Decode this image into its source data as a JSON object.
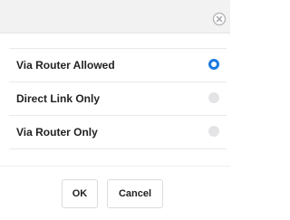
{
  "dialog": {
    "close_icon": "close-circle-icon",
    "options": [
      {
        "label": "Via Router Allowed",
        "selected": true
      },
      {
        "label": "Direct Link Only",
        "selected": false
      },
      {
        "label": "Via Router Only",
        "selected": false
      }
    ],
    "buttons": {
      "ok_label": "OK",
      "cancel_label": "Cancel"
    }
  },
  "colors": {
    "accent": "#1c7be0",
    "titlebar": "#f2f2f3",
    "radio_off": "#e4e4e6"
  }
}
